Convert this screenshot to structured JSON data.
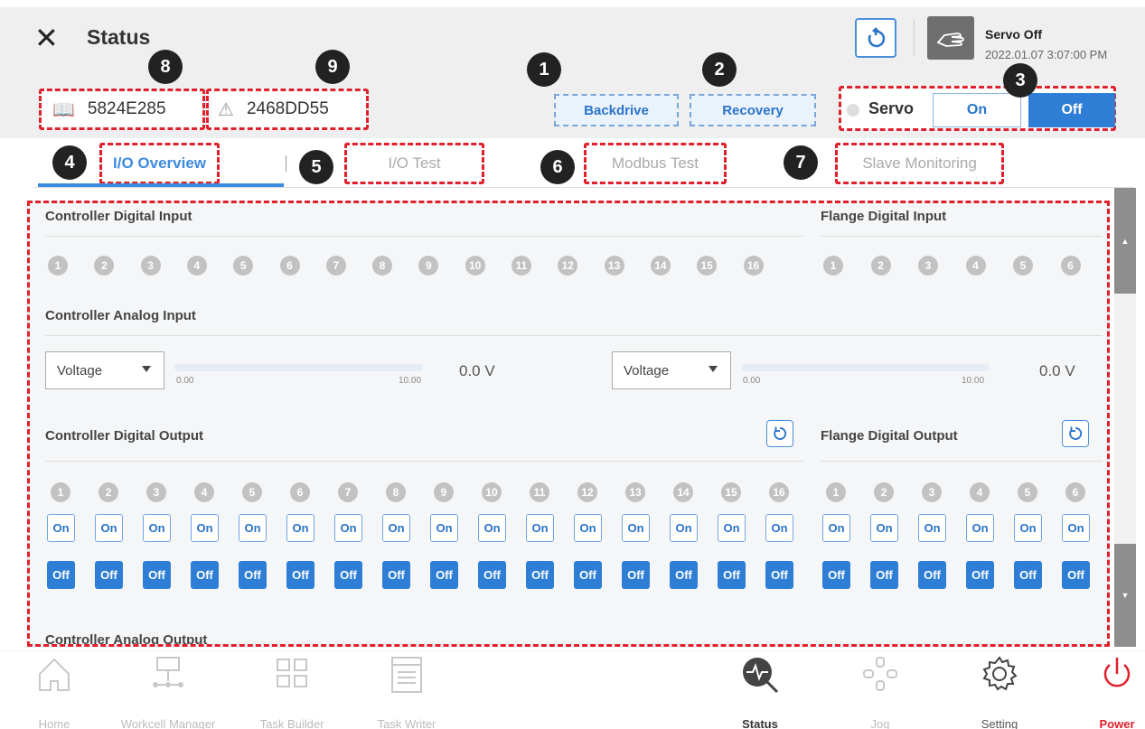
{
  "header": {
    "title": "Status",
    "servo_state": "Servo Off",
    "datetime": "2022.01.07 3:07:00 PM"
  },
  "ids": {
    "robot_id": "5824E285",
    "controller_id": "2468DD55"
  },
  "actions": {
    "backdrive": "Backdrive",
    "recovery": "Recovery"
  },
  "servo": {
    "label": "Servo",
    "on": "On",
    "off": "Off"
  },
  "tabs": [
    "I/O Overview",
    "I/O Test",
    "Modbus Test",
    "Slave Monitoring"
  ],
  "callouts": [
    "1",
    "2",
    "3",
    "4",
    "5",
    "6",
    "7",
    "8",
    "9"
  ],
  "sections": {
    "ctrl_di": "Controller Digital Input",
    "flange_di": "Flange Digital Input",
    "ctrl_ai": "Controller Analog Input",
    "ctrl_do": "Controller Digital Output",
    "flange_do": "Flange Digital Output",
    "ctrl_ao": "Controller Analog Output"
  },
  "ctrl_channels": [
    "1",
    "2",
    "3",
    "4",
    "5",
    "6",
    "7",
    "8",
    "9",
    "10",
    "11",
    "12",
    "13",
    "14",
    "15",
    "16"
  ],
  "flange_channels": [
    "1",
    "2",
    "3",
    "4",
    "5",
    "6"
  ],
  "analog": [
    {
      "mode": "Voltage",
      "min": "0.00",
      "max": "10.00",
      "value": "0.0 V"
    },
    {
      "mode": "Voltage",
      "min": "0.00",
      "max": "10.00",
      "value": "0.0 V"
    }
  ],
  "output_labels": {
    "on": "On",
    "off": "Off"
  },
  "nav": [
    "Home",
    "Workcell Manager",
    "Task Builder",
    "Task Writer",
    "Status",
    "Jog",
    "Setting",
    "Power"
  ],
  "colors": {
    "accent": "#2f7ed6",
    "callout_border": "#e0202a",
    "power": "#e0202a"
  }
}
